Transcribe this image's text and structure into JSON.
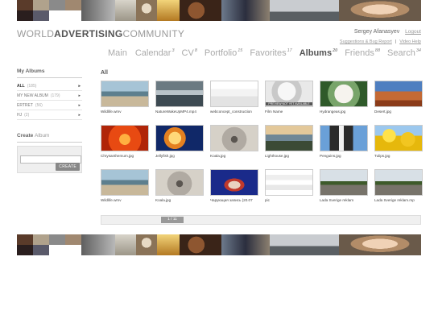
{
  "banner": {
    "swatches": [
      "#5a3b2a",
      "#b0a28c",
      "#8a8a8a",
      "#a08870",
      "#2a1e1e",
      "#5a5a6a",
      "#ffffff",
      "#ffffff"
    ],
    "tiles": [
      {
        "name": "gray-strip",
        "color": "#8c8c8c"
      },
      {
        "name": "gull-photo",
        "color": "#c8c2b6"
      },
      {
        "name": "dog-photo",
        "color": "#b5a489"
      },
      {
        "name": "sunset-photo",
        "color": "#d9a441"
      },
      {
        "name": "candy-photo",
        "color": "#5a3a25"
      },
      {
        "name": "figures-photo",
        "color": "#3e3d4e"
      },
      {
        "name": "car-photo",
        "color": "#9ca3a8"
      },
      {
        "name": "face-photo",
        "color": "#d6b39a"
      }
    ]
  },
  "logo": {
    "part1": "WORLD",
    "part2": "ADVERTISING",
    "part3": "COMMUNITY"
  },
  "user": {
    "name": "Sergey Afanasyev",
    "logout": "Logout",
    "suggestions": "Suggestions & Bug Report",
    "help": "Video Help"
  },
  "nav": [
    {
      "label": "Main",
      "count": ""
    },
    {
      "label": "Calendar",
      "count": "3"
    },
    {
      "label": "CV",
      "count": "8"
    },
    {
      "label": "Portfolio",
      "count": "15"
    },
    {
      "label": "Favorites",
      "count": "17"
    },
    {
      "label": "Albums",
      "count": "20"
    },
    {
      "label": "Friends",
      "count": "88"
    },
    {
      "label": "Search",
      "count": "34"
    }
  ],
  "sidebar": {
    "title": "My Albums",
    "albums": [
      {
        "name": "ALL",
        "count": "(185)"
      },
      {
        "name": "MY NEW ALBUM",
        "count": "(179)"
      },
      {
        "name": "ERTRET",
        "count": "(56)"
      },
      {
        "name": "HJ",
        "count": "(2)"
      }
    ],
    "create_title_bold": "Create",
    "create_title_light": "Album",
    "create_button": "CREATE"
  },
  "main": {
    "title": "All",
    "items": [
      {
        "caption": "Wildlife.wmv",
        "icon": "wild-thumb"
      },
      {
        "caption": "NatureWakeUpMP4.mp4",
        "icon": "surf-thumb"
      },
      {
        "caption": "webconcept_construction",
        "icon": "web-thumb"
      },
      {
        "caption": "Film Name",
        "icon": "film-thumb",
        "overlay": "PREVIEW NOT YET AVAILABLE"
      },
      {
        "caption": "Hydrangeas.jpg",
        "icon": "hydr-thumb"
      },
      {
        "caption": "Desert.jpg",
        "icon": "desert-thumb"
      },
      {
        "caption": "Chrysanthemum.jpg",
        "icon": "chry-thumb"
      },
      {
        "caption": "Jellyfish.jpg",
        "icon": "jelly-thumb"
      },
      {
        "caption": "Koala.jpg",
        "icon": "koala-thumb"
      },
      {
        "caption": "Lighthouse.jpg",
        "icon": "light-thumb"
      },
      {
        "caption": "Penguins.jpg",
        "icon": "peng-thumb"
      },
      {
        "caption": "Tulips.jpg",
        "icon": "tulip-thumb"
      },
      {
        "caption": "Wildlife.wmv",
        "icon": "wild-thumb"
      },
      {
        "caption": "Koala.jpg",
        "icon": "koala-thumb"
      },
      {
        "caption": "Чарующая запись (20.07",
        "icon": "tv-thumb"
      },
      {
        "caption": "pic",
        "icon": "pic-thumb"
      },
      {
        "caption": "Lada Sverige reklam",
        "icon": "lada-thumb"
      },
      {
        "caption": "Lada Sverige reklam.mp",
        "icon": "lada-thumb"
      }
    ],
    "pager": "1 / 11"
  }
}
